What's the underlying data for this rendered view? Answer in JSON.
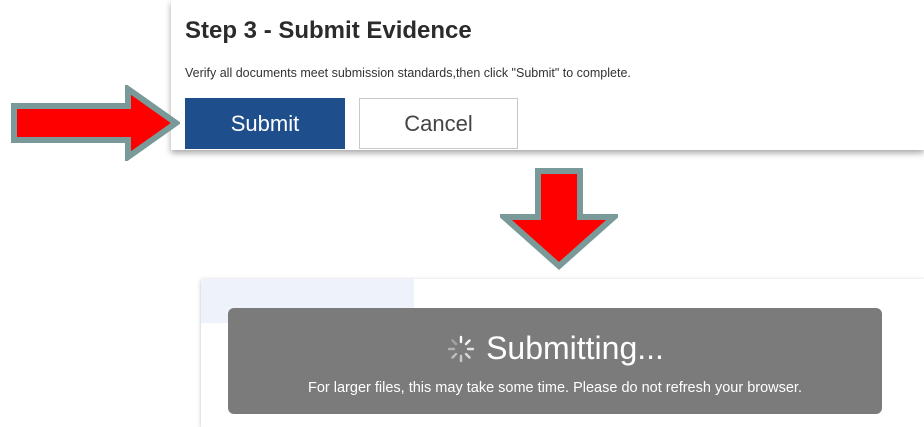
{
  "step": {
    "title": "Step 3 - Submit Evidence",
    "description": "Verify all documents meet submission standards,then click \"Submit\" to complete.",
    "submit_label": "Submit",
    "cancel_label": "Cancel"
  },
  "overlay": {
    "status_text": "Submitting...",
    "note": "For larger files, this may take some time. Please do not refresh your browser."
  },
  "colors": {
    "submit_button": "#1f4e8c",
    "arrow_fill": "#ff0000",
    "arrow_outline": "#7a9a9a",
    "overlay_bg": "#7b7b7b"
  },
  "icons": {
    "spinner": "loading-spinner-icon",
    "arrow_right": "arrow-right-icon",
    "arrow_down": "arrow-down-icon"
  }
}
